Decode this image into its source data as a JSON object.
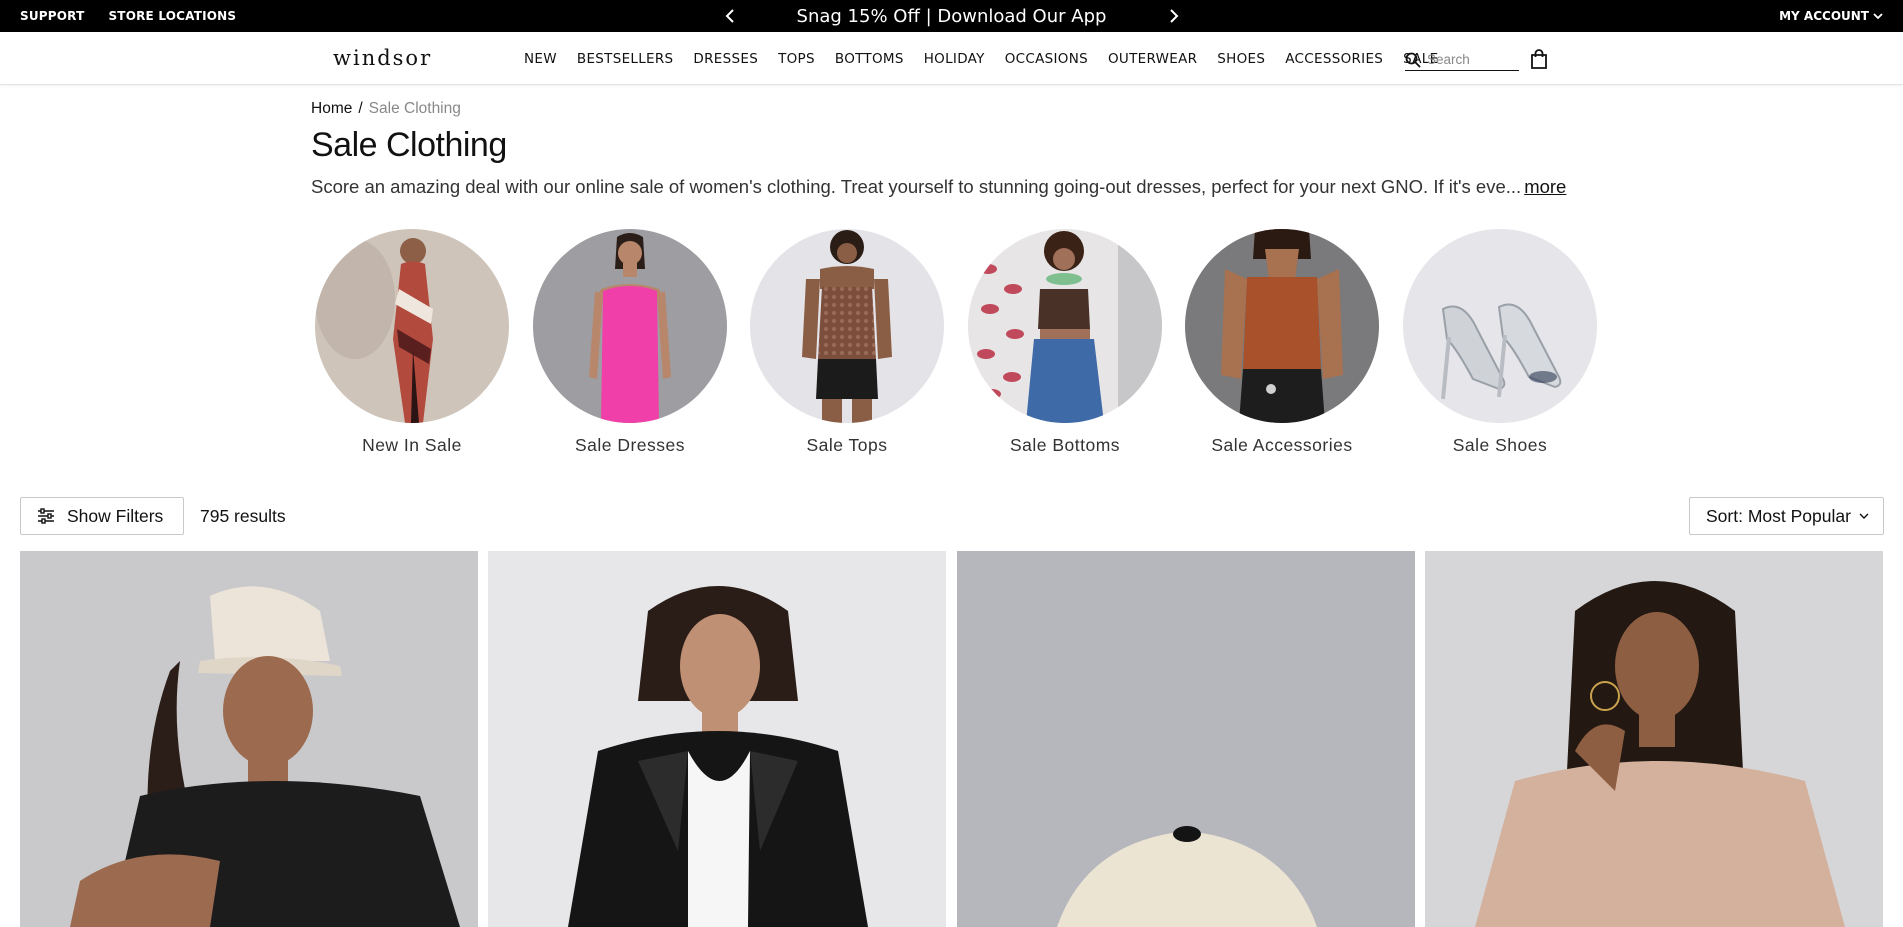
{
  "topbar": {
    "support": "SUPPORT",
    "store_locations": "STORE LOCATIONS",
    "promo": "Snag 15% Off | Download Our App",
    "account": "MY ACCOUNT"
  },
  "brand": {
    "logo": "windsor"
  },
  "nav": [
    "NEW",
    "BESTSELLERS",
    "DRESSES",
    "TOPS",
    "BOTTOMS",
    "HOLIDAY",
    "OCCASIONS",
    "OUTERWEAR",
    "SHOES",
    "ACCESSORIES",
    "SALE"
  ],
  "search": {
    "placeholder": "Search"
  },
  "breadcrumb": {
    "home": "Home",
    "separator": "/",
    "current": "Sale Clothing"
  },
  "page": {
    "title": "Sale Clothing",
    "description": "Score an amazing deal with our online sale of women's clothing. Treat yourself to stunning going-out dresses, perfect for your next GNO. If it's eve...",
    "more": "more"
  },
  "categories": [
    {
      "label": "New In Sale",
      "bg": "#cfc4ba"
    },
    {
      "label": "Sale Dresses",
      "bg": "#9e9da2"
    },
    {
      "label": "Sale Tops",
      "bg": "#e4e3e8"
    },
    {
      "label": "Sale Bottoms",
      "bg": "#dcdcdc"
    },
    {
      "label": "Sale Accessories",
      "bg": "#7a7a7c"
    },
    {
      "label": "Sale Shoes",
      "bg": "#e6e6ea"
    }
  ],
  "toolbar": {
    "filters": "Show Filters",
    "results": "795 results",
    "sort": "Sort: Most Popular"
  },
  "products": [
    {
      "name": "product-cap-sweater",
      "bg": "#c9c9cb"
    },
    {
      "name": "product-leather-jacket",
      "bg": "#e7e7e9"
    },
    {
      "name": "product-cap",
      "bg": "#b6b6bd"
    },
    {
      "name": "product-knit-sweater",
      "bg": "#d6d6d8"
    }
  ]
}
